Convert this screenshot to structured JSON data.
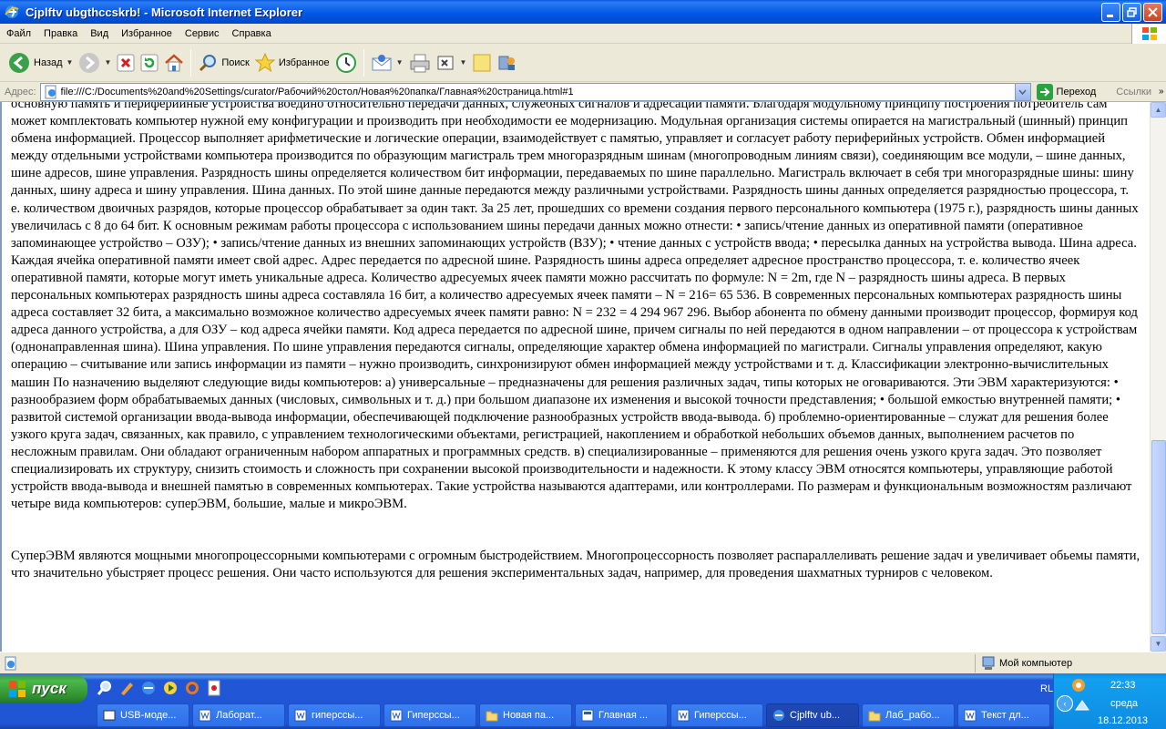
{
  "window": {
    "title": "Cjplftv ubgthccskrb! - Microsoft Internet Explorer"
  },
  "menu": [
    "Файл",
    "Правка",
    "Вид",
    "Избранное",
    "Сервис",
    "Справка"
  ],
  "toolbar": {
    "back_label": "Назад",
    "search_label": "Поиск",
    "favorites_label": "Избранное"
  },
  "address": {
    "label": "Адрес:",
    "url": "file:///C:/Documents%20and%20Settings/curator/Рабочий%20стол/Новая%20папка/Главная%20страница.html#1",
    "go_label": "Переход",
    "links_label": "Ссылки"
  },
  "content": {
    "paragraph1": "основную память и периферийные устройства воедино относительно передачи данных, служебных сигналов и адресации памяти. Благодаря модульному принципу построения потребитель сам может комплектовать компьютер нужной ему конфигурации и производить при необходимости ее модернизацию. Модульная организация системы опирается на магистральный (шинный) принцип обмена информацией. Процессор выполняет арифметические и логические операции, взаимодействует с памятью, управляет и согласует работу периферийных устройств. Обмен информацией между отдельными устройствами компьютера производится по образующим магистраль трем многоразрядным шинам (многопроводным линиям связи), соединяющим все модули, – шине данных, шине адресов, шине управления. Разрядность шины определяется количеством бит информации, передаваемых по шине параллельно. Магистраль включает в себя три многоразрядные шины: шину данных, шину адреса и шину управления. Шина данных. По этой шине данные передаются между различными устройствами. Разрядность шины данных определяется разрядностью процессора, т. е. количеством двоичных разрядов, которые процессор обрабатывает за один такт. За 25 лет, прошедших со времени создания первого персонального компьютера (1975 г.), разрядность шины данных увеличилась с 8 до 64 бит. К основным режимам работы процессора с использованием шины передачи данных можно отнести: • запись/чтение данных из оперативной памяти (оперативное запоминающее устройство – ОЗУ); • запись/чтение данных из внешних запоминающих устройств (ВЗУ); • чтение данных с устройств ввода; • пересылка данных на устройства вывода. Шина адреса. Каждая ячейка оперативной памяти имеет свой адрес. Адрес передается по адресной шине. Разрядность шины адреса определяет адресное пространство процессора, т. е. количество ячеек оперативной памяти, которые могут иметь уникальные адреса. Количество адресуемых ячеек памяти можно рассчитать по формуле: N = 2m, где N – разрядность шины адреса. В первых персональных компьютерах разрядность шины адреса составляла 16 бит, а количество адресуемых ячеек памяти – N = 216= 65 536. В современных персональных компьютерах разрядность шины адреса составляет 32 бита, а максимально возможное количество адресуемых ячеек памяти равно: N = 232 = 4 294 967 296. Выбор абонента по обмену данными производит процессор, формируя код адреса данного устройства, а для ОЗУ – код адреса ячейки памяти. Код адреса передается по адресной шине, причем сигналы по ней передаются в одном направлении – от процессора к устройствам (однонаправленная шина). Шина управления. По шине управления передаются сигналы, определяющие характер обмена информацией по магистрали. Сигналы управления определяют, какую операцию – считывание или запись информации из памяти – нужно производить, синхронизируют обмен информацией между устройствами и т. д. Классификации электронно-вычислительных машин По назначению выделяют следующие виды компьютеров: а) универсальные – предназначены для решения различных задач, типы которых не оговариваются. Эти ЭВМ характеризуются: • разнообразием форм обрабатываемых данных (числовых, символьных и т. д.) при большом диапазоне их изменения и высокой точности представления; • большой емкостью внутренней памяти; • развитой системой организации ввода-вывода информации, обеспечивающей подключение разнообразных устройств ввода-вывода. б) проблемно-ориентированные – служат для решения более узкого круга задач, связанных, как правило, с управлением технологическими объектами, регистрацией, накоплением и обработкой небольших объемов данных, выполнением расчетов по несложным правилам. Они обладают ограниченным набором аппаратных и программных средств. в) специализированные – применяются для решения очень узкого круга задач. Это позволяет специализировать их структуру, снизить стоимость и сложность при сохранении высокой производительности и надежности. К этому классу ЭВМ относятся компьютеры, управляющие работой устройств ввода-вывода и внешней памятью в современных компьютерах. Такие устройства называются адаптерами, или контроллерами. По размерам и функциональным возможностям различают четыре вида компьютеров: суперЭВМ, большие, малые и микроЭВМ.",
    "paragraph2": "СуперЭВМ являются мощными многопроцессорными компьютерами с огромным быстродействием. Многопроцессорность позволяет распараллеливать решение задач и увеличивает обьемы памяти, что значительно убыстряет процесс решения. Они часто используются для решения экспериментальных задач, например, для проведения шахматных турниров с человеком."
  },
  "status": {
    "zone_label": "Мой компьютер"
  },
  "taskbar": {
    "start_label": "пуск",
    "tasks": [
      {
        "label": "USB-моде..."
      },
      {
        "label": "Лаборат..."
      },
      {
        "label": "гиперссы..."
      },
      {
        "label": "Гиперссы..."
      },
      {
        "label": "Новая па..."
      },
      {
        "label": "Главная ..."
      },
      {
        "label": "Гиперссы..."
      },
      {
        "label": "Cjplftv ub..."
      },
      {
        "label": "Лаб_рабо..."
      },
      {
        "label": "Текст дл..."
      }
    ],
    "lang": "RL",
    "time": "22:33",
    "day": "среда",
    "date": "18.12.2013"
  }
}
